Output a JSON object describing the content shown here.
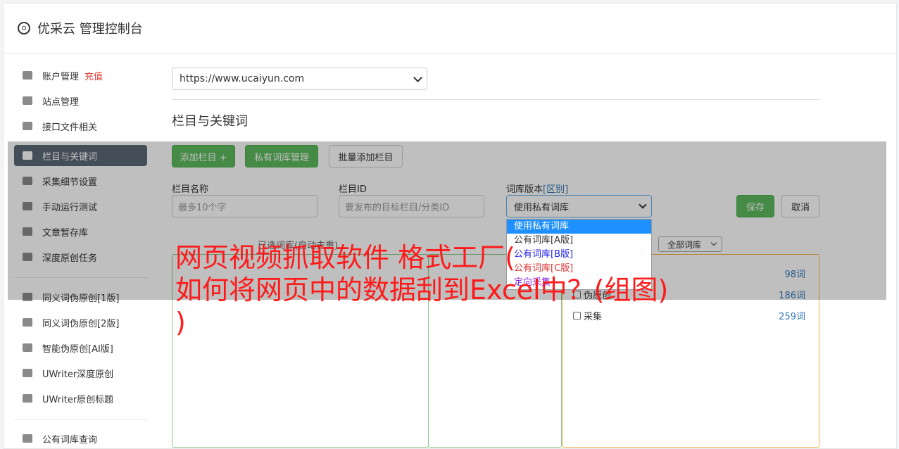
{
  "header": {
    "title": "优采云 管理控制台"
  },
  "sidebar": {
    "recharge_label": "充值",
    "items": [
      {
        "label": "账户管理"
      },
      {
        "label": "站点管理"
      },
      {
        "label": "接口文件相关"
      },
      {
        "label": "栏目与关键词"
      },
      {
        "label": "采集细节设置"
      },
      {
        "label": "手动运行测试"
      },
      {
        "label": "文章暂存库"
      },
      {
        "label": "深度原创任务"
      },
      {
        "label": "同义词伪原创[1版]"
      },
      {
        "label": "同义词伪原创[2版]"
      },
      {
        "label": "智能伪原创[AI版]"
      },
      {
        "label": "UWriter深度原创"
      },
      {
        "label": "UWriter原创标题"
      },
      {
        "label": "公有词库查询"
      }
    ]
  },
  "main": {
    "site_select_value": "https://www.ucaiyun.com",
    "section_title": "栏目与关键词",
    "buttons": {
      "add_column": "添加栏目 +",
      "private_lib": "私有词库管理",
      "batch_add": "批量添加栏目",
      "save": "保存",
      "cancel": "取消"
    },
    "form": {
      "column_name_label": "栏目名称",
      "column_name_placeholder": "最多10个字",
      "column_id_label": "栏目ID",
      "column_id_placeholder": "要发布的目标栏目/分类ID",
      "version_label": "词库版本",
      "version_link": "[区别]",
      "version_value": "使用私有词库",
      "version_options": [
        "使用私有词库",
        "公有词库[A版]",
        "公有词库[B版]",
        "公有词库[C版]",
        "定向采集"
      ]
    },
    "selected_lib_title": "已选词库(自动去重)",
    "lib_filter_value": "全部词库",
    "libs": [
      {
        "name": "",
        "count": "98词"
      },
      {
        "name": "伪原创",
        "count": "186词"
      },
      {
        "name": "采集",
        "count": "259词"
      }
    ]
  },
  "watermark": {
    "text": "网页视频抓取软件 格式工厂(\n如何将网页中的数据刮到Excel中？(组图)\n)"
  }
}
